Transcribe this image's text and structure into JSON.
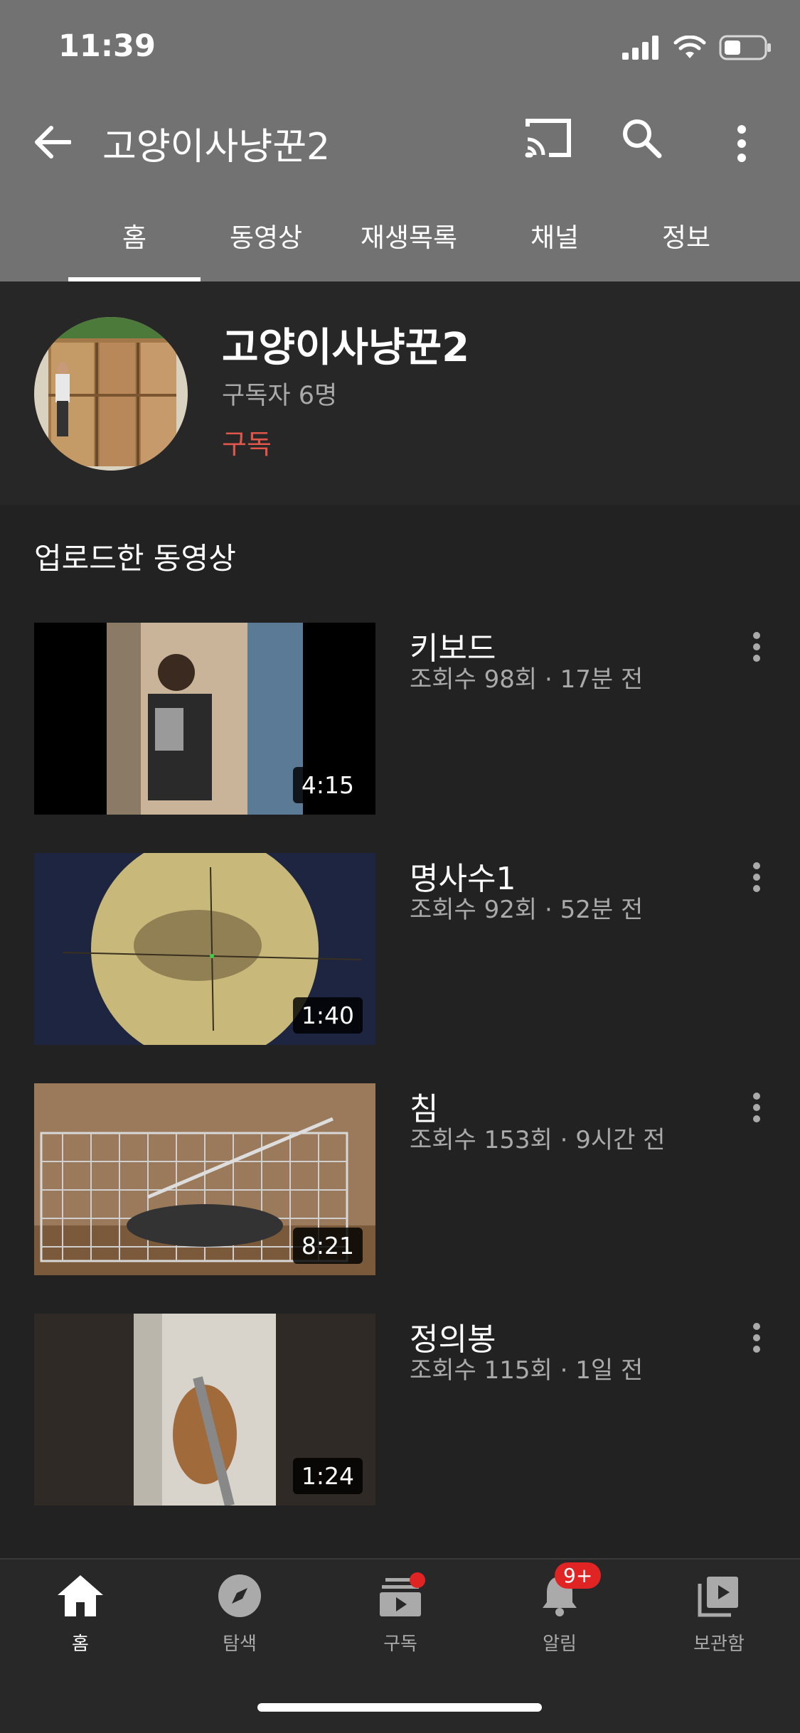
{
  "status_bar": {
    "time": "11:39"
  },
  "appbar": {
    "title": "고양이사냥꾼2"
  },
  "tabs": [
    {
      "label": "홈"
    },
    {
      "label": "동영상"
    },
    {
      "label": "재생목록"
    },
    {
      "label": "채널"
    },
    {
      "label": "정보"
    }
  ],
  "active_tab": 0,
  "channel": {
    "name": "고양이사냥꾼2",
    "subscribers": "구독자 6명",
    "subscribe_label": "구독"
  },
  "section": {
    "title": "업로드한 동영상"
  },
  "videos": [
    {
      "title": "키보드",
      "meta": "조회수 98회 · 17분 전",
      "duration": "4:15"
    },
    {
      "title": "명사수1",
      "meta": "조회수 92회 · 52분 전",
      "duration": "1:40"
    },
    {
      "title": "침",
      "meta": "조회수 153회 · 9시간 전",
      "duration": "8:21"
    },
    {
      "title": "정의봉",
      "meta": "조회수 115회 · 1일 전",
      "duration": "1:24"
    }
  ],
  "bottom_nav": [
    {
      "label": "홈",
      "icon": "home-icon"
    },
    {
      "label": "탐색",
      "icon": "compass-icon"
    },
    {
      "label": "구독",
      "icon": "subscriptions-icon"
    },
    {
      "label": "알림",
      "icon": "bell-icon",
      "badge": "9+"
    },
    {
      "label": "보관함",
      "icon": "library-icon"
    }
  ],
  "colors": {
    "header_bg": "#727272",
    "page_bg": "#222222",
    "channel_bg": "#272727",
    "accent_red": "#e1564a",
    "badge_red": "#e02424"
  }
}
